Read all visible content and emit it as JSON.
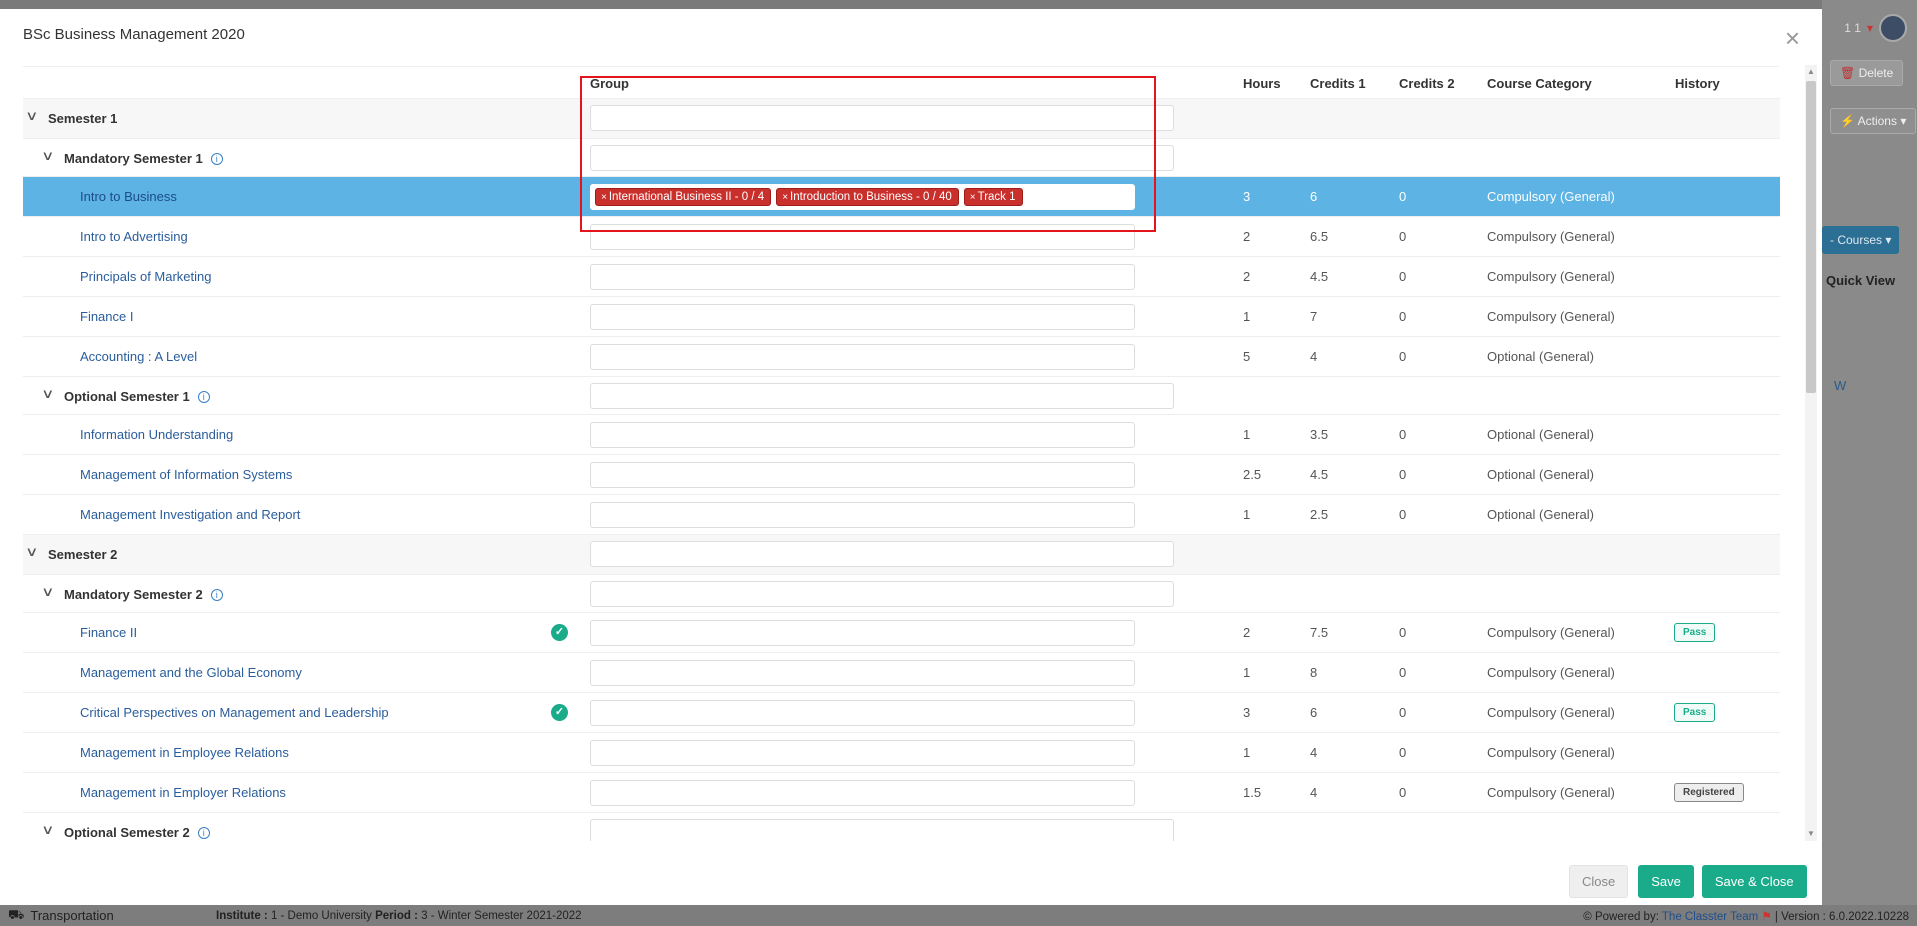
{
  "modal": {
    "title": "BSc Business Management 2020",
    "columns": {
      "group": "Group",
      "hours": "Hours",
      "credits1": "Credits 1",
      "credits2": "Credits 2",
      "category": "Course Category",
      "history": "History"
    },
    "rows": [
      {
        "type": "group",
        "label": "Semester 1"
      },
      {
        "type": "sub",
        "label": "Mandatory Semester 1",
        "info": true
      },
      {
        "type": "course",
        "label": "Intro to Business",
        "selected": true,
        "hours": "3",
        "credits1": "6",
        "credits2": "0",
        "category": "Compulsory (General)",
        "tags": [
          "International Business II - 0 / 4",
          "Introduction to Business - 0 / 40",
          "Track 1"
        ]
      },
      {
        "type": "course",
        "label": "Intro to Advertising",
        "hours": "2",
        "credits1": "6.5",
        "credits2": "0",
        "category": "Compulsory (General)"
      },
      {
        "type": "course",
        "label": "Principals of Marketing",
        "hours": "2",
        "credits1": "4.5",
        "credits2": "0",
        "category": "Compulsory (General)"
      },
      {
        "type": "course",
        "label": "Finance I",
        "hours": "1",
        "credits1": "7",
        "credits2": "0",
        "category": "Compulsory (General)"
      },
      {
        "type": "course",
        "label": "Accounting : A Level",
        "hours": "5",
        "credits1": "4",
        "credits2": "0",
        "category": "Optional (General)"
      },
      {
        "type": "sub",
        "label": "Optional Semester 1",
        "info": true
      },
      {
        "type": "course",
        "label": "Information Understanding",
        "hours": "1",
        "credits1": "3.5",
        "credits2": "0",
        "category": "Optional (General)"
      },
      {
        "type": "course",
        "label": "Management of Information Systems",
        "hours": "2.5",
        "credits1": "4.5",
        "credits2": "0",
        "category": "Optional (General)"
      },
      {
        "type": "course",
        "label": "Management Investigation and Report",
        "hours": "1",
        "credits1": "2.5",
        "credits2": "0",
        "category": "Optional (General)"
      },
      {
        "type": "group",
        "label": "Semester 2"
      },
      {
        "type": "sub",
        "label": "Mandatory Semester 2",
        "info": true
      },
      {
        "type": "course",
        "label": "Finance II",
        "check": true,
        "hours": "2",
        "credits1": "7.5",
        "credits2": "0",
        "category": "Compulsory (General)",
        "history": "Pass"
      },
      {
        "type": "course",
        "label": "Management and the Global Economy",
        "hours": "1",
        "credits1": "8",
        "credits2": "0",
        "category": "Compulsory (General)"
      },
      {
        "type": "course",
        "label": "Critical Perspectives on Management and Leadership",
        "check": true,
        "hours": "3",
        "credits1": "6",
        "credits2": "0",
        "category": "Compulsory (General)",
        "history": "Pass"
      },
      {
        "type": "course",
        "label": "Management in Employee Relations",
        "hours": "1",
        "credits1": "4",
        "credits2": "0",
        "category": "Compulsory (General)"
      },
      {
        "type": "course",
        "label": "Management in Employer Relations",
        "hours": "1.5",
        "credits1": "4",
        "credits2": "0",
        "category": "Compulsory (General)",
        "history": "Registered"
      },
      {
        "type": "sub",
        "label": "Optional Semester 2",
        "info": true
      }
    ],
    "buttons": {
      "close": "Close",
      "save": "Save",
      "save_close": "Save & Close"
    }
  },
  "background": {
    "top_right": "1 1",
    "delete": "Delete",
    "actions": "Actions",
    "courses": "- Courses",
    "quick_view": "Quick View",
    "w": "W"
  },
  "statusbar": {
    "module": "Transportation",
    "institute_label": "Institute :",
    "institute_value": " 1 - Demo University ",
    "period_label": "Period :",
    "period_value": " 3 - Winter Semester 2021-2022",
    "powered_by": "Powered by:",
    "team": "The Classter Team",
    "version": "| Version : 6.0.2022.10228"
  },
  "colors": {
    "accent": "#1aab8a",
    "selected_row": "#5cb3e4",
    "tag": "#c9302c",
    "highlight": "#e3141c"
  }
}
